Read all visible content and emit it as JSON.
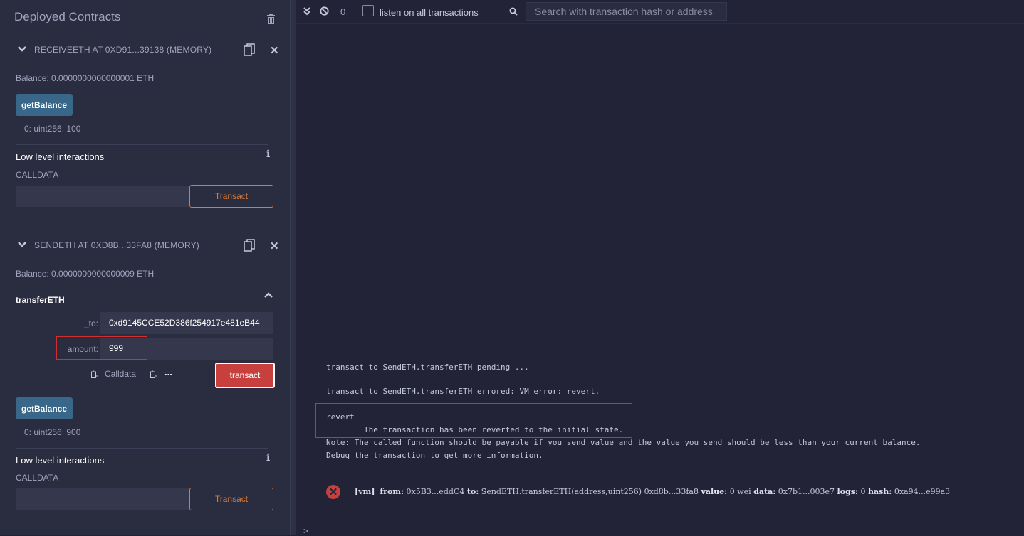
{
  "panel": {
    "title": "Deployed Contracts"
  },
  "contracts": [
    {
      "name": "RECEIVEETH AT 0XD91...39138 (MEMORY)",
      "balance": "Balance: 0.0000000000000001 ETH",
      "getBalance_label": "getBalance",
      "output": "0: uint256: 100",
      "low_level_title": "Low level interactions",
      "calldata_label": "CALLDATA",
      "transact_label": "Transact"
    },
    {
      "name": "SENDETH AT 0XD8B...33FA8 (MEMORY)",
      "balance": "Balance: 0.0000000000000009 ETH",
      "function": {
        "title": "transferETH",
        "params": [
          {
            "label": "_to:",
            "value": "0xd9145CCE52D386f254917e481eB44"
          },
          {
            "label": "amount:",
            "value": "999"
          }
        ],
        "calldata_label": "Calldata",
        "more": "...",
        "transact_label": "transact"
      },
      "getBalance_label": "getBalance",
      "output": "0: uint256: 900",
      "low_level_title": "Low level interactions",
      "calldata_label": "CALLDATA",
      "transact_label": "Transact"
    }
  ],
  "terminal": {
    "count": "0",
    "listen_label": "listen on all transactions",
    "search_placeholder": "Search with transaction hash or address",
    "lines": [
      "transact to SendETH.transferETH pending ...",
      "transact to SendETH.transferETH errored: VM error: revert.",
      "revert",
      "\tThe transaction has been reverted to the initial state.",
      "Note: The called function should be payable if you send value and the value you send should be less than your current balance.",
      "Debug the transaction to get more information."
    ],
    "tx": {
      "vm": "[vm]",
      "from_key": "from:",
      "from_val": "0x5B3...eddC4",
      "to_key": "to:",
      "to_val": "SendETH.transferETH(address,uint256) 0xd8b...33fa8",
      "value_key": "value:",
      "value_val": "0 wei",
      "data_key": "data:",
      "data_val": "0x7b1...003e7",
      "logs_key": "logs:",
      "logs_val": "0",
      "hash_key": "hash:",
      "hash_val": "0xa94...e99a3"
    },
    "prompt": ">"
  },
  "colors": {
    "accent_blue": "#39678a",
    "transact_red": "#c8403e",
    "transact_outline": "#d77a3b",
    "highlight_red": "#d32f2f"
  }
}
